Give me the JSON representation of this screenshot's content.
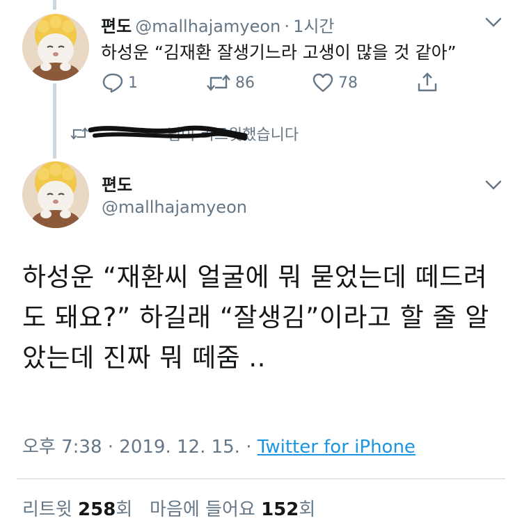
{
  "first_tweet": {
    "author_name": "편도",
    "author_handle": "@mallhajamyeon",
    "time_sep": "·",
    "time_ago": "1시간",
    "text": "하성운 “김재환 잘생기느라 고생이 많을 것 같아”",
    "reply_count": "1",
    "retweet_count": "86",
    "like_count": "78"
  },
  "retweet_banner": {
    "text": "님이 리트윗했습니다"
  },
  "main_tweet": {
    "author_name": "편도",
    "author_handle": "@mallhajamyeon",
    "text": "하성운 “재환씨 얼굴에 뭐 묻었는데 떼드려도 돼요?” 하길래 “잘생김”이라고 할 줄 알았는데 진짜 뭐 떼줌 ..",
    "time": "오후 7:38 · 2019. 12. 15. · ",
    "source": "Twitter for iPhone",
    "retweets_label": "리트윗",
    "retweets_count": "258",
    "retweets_suffix": "회",
    "likes_label": "마음에 들어요",
    "likes_count": "152",
    "likes_suffix": "회"
  },
  "colors": {
    "accent": "#1b95e0",
    "text": "#14171a",
    "muted": "#657786",
    "border": "#ccd6dd"
  }
}
